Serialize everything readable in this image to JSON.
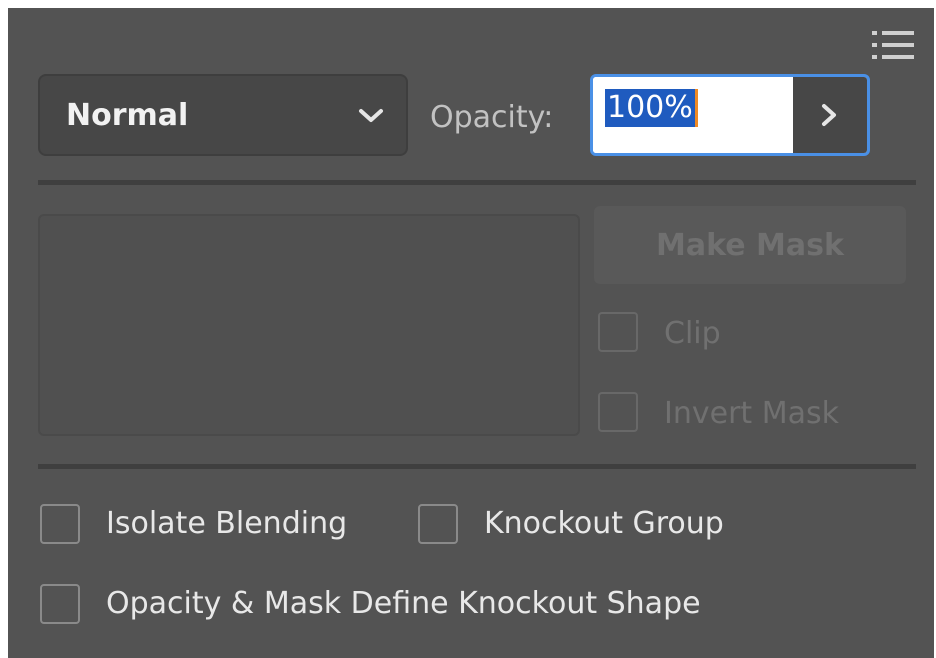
{
  "panel": {
    "menu_icon": "panel-menu-icon",
    "blend_mode": {
      "selected": "Normal",
      "icon": "chevron-down-icon"
    },
    "opacity": {
      "label": "Opacity:",
      "value": "100%",
      "icon": "chevron-right-icon"
    },
    "make_mask_label": "Make Mask",
    "clip_label": "Clip",
    "invert_mask_label": "Invert Mask",
    "isolate_blending_label": "Isolate Blending",
    "knockout_group_label": "Knockout Group",
    "opacity_mask_define_label": "Opacity & Mask Define Knockout Shape"
  },
  "colors": {
    "panel_bg": "#535353",
    "focus_border": "#4a90e6",
    "selection": "#1f5bbf",
    "caret": "#f08a24"
  }
}
